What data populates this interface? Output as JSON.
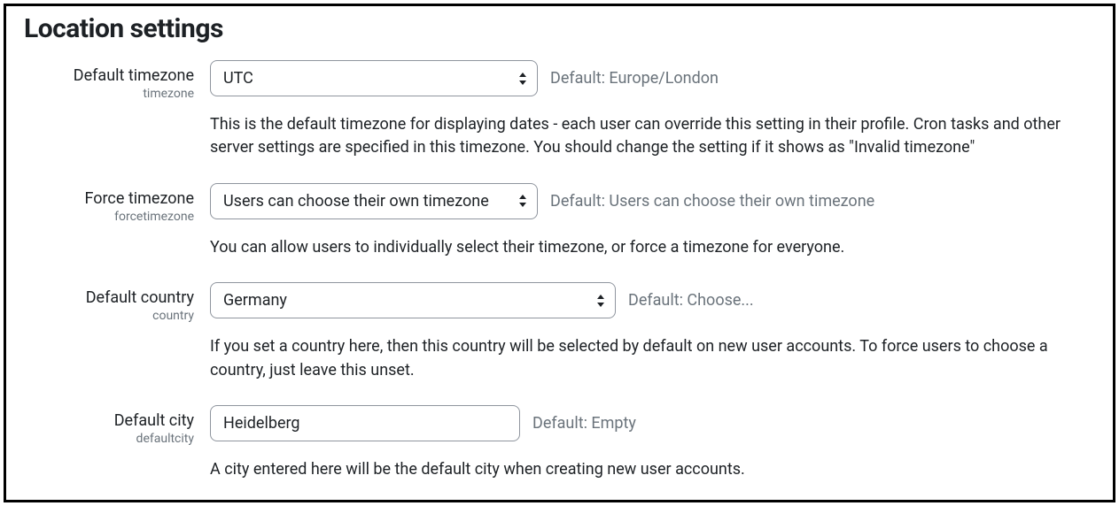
{
  "page": {
    "title": "Location settings"
  },
  "settings": {
    "timezone": {
      "label": "Default timezone",
      "name": "timezone",
      "value": "UTC",
      "default_hint": "Default: Europe/London",
      "description": "This is the default timezone for displaying dates - each user can override this setting in their profile. Cron tasks and other server settings are specified in this timezone. You should change the setting if it shows as \"Invalid timezone\""
    },
    "forcetimezone": {
      "label": "Force timezone",
      "name": "forcetimezone",
      "value": "Users can choose their own timezone",
      "default_hint": "Default: Users can choose their own timezone",
      "description": "You can allow users to individually select their timezone, or force a timezone for everyone."
    },
    "country": {
      "label": "Default country",
      "name": "country",
      "value": "Germany",
      "default_hint": "Default: Choose...",
      "description": "If you set a country here, then this country will be selected by default on new user accounts. To force users to choose a country, just leave this unset."
    },
    "defaultcity": {
      "label": "Default city",
      "name": "defaultcity",
      "value": "Heidelberg",
      "default_hint": "Default: Empty",
      "description": "A city entered here will be the default city when creating new user accounts."
    }
  }
}
